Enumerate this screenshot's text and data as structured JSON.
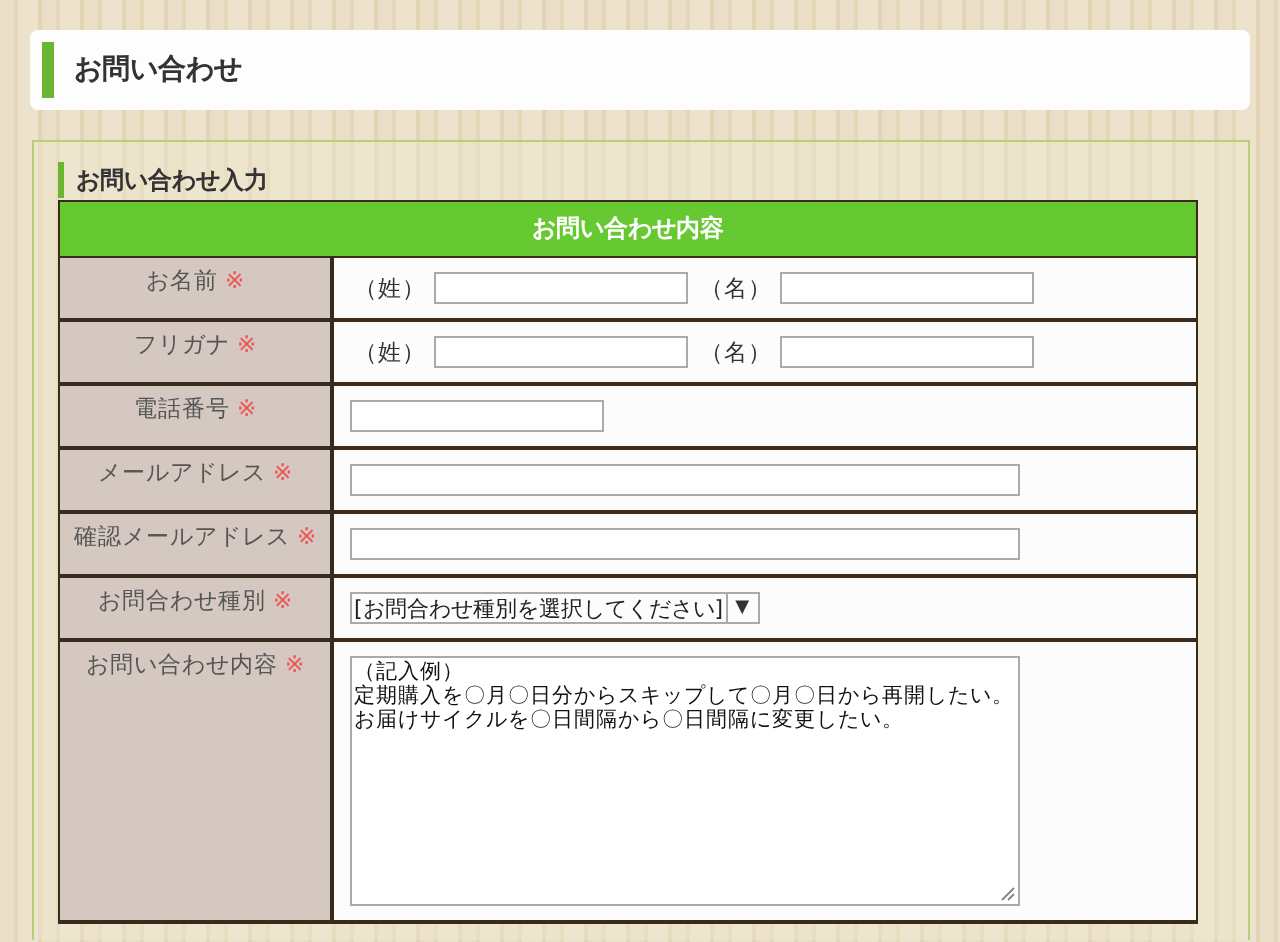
{
  "page_title": "お問い合わせ",
  "section_title": "お問い合わせ入力",
  "form": {
    "header": "お問い合わせ内容",
    "rows": [
      {
        "kind": "name-pair",
        "label": "お名前",
        "required_mark": "※",
        "parts": [
          {
            "label": "（姓）"
          },
          {
            "label": "（名）"
          }
        ]
      },
      {
        "kind": "name-pair",
        "label": "フリガナ",
        "required_mark": "※",
        "parts": [
          {
            "label": "（姓）"
          },
          {
            "label": "（名）"
          }
        ]
      },
      {
        "kind": "short",
        "label": "電話番号",
        "required_mark": "※"
      },
      {
        "kind": "long",
        "label": "メールアドレス",
        "required_mark": "※"
      },
      {
        "kind": "long",
        "label": "確認メールアドレス",
        "required_mark": "※"
      },
      {
        "kind": "select",
        "label": "お問合わせ種別",
        "required_mark": "※",
        "value": "[お問合わせ種別を選択してください]",
        "arrow": "▼"
      },
      {
        "kind": "textarea",
        "label": "お問い合わせ内容",
        "required_mark": "※",
        "lines": [
          "（記入例）",
          "定期購入を〇月〇日分からスキップして〇月〇日から再開したい。",
          "お届けサイクルを〇日間隔から〇日間隔に変更したい。"
        ]
      }
    ]
  }
}
